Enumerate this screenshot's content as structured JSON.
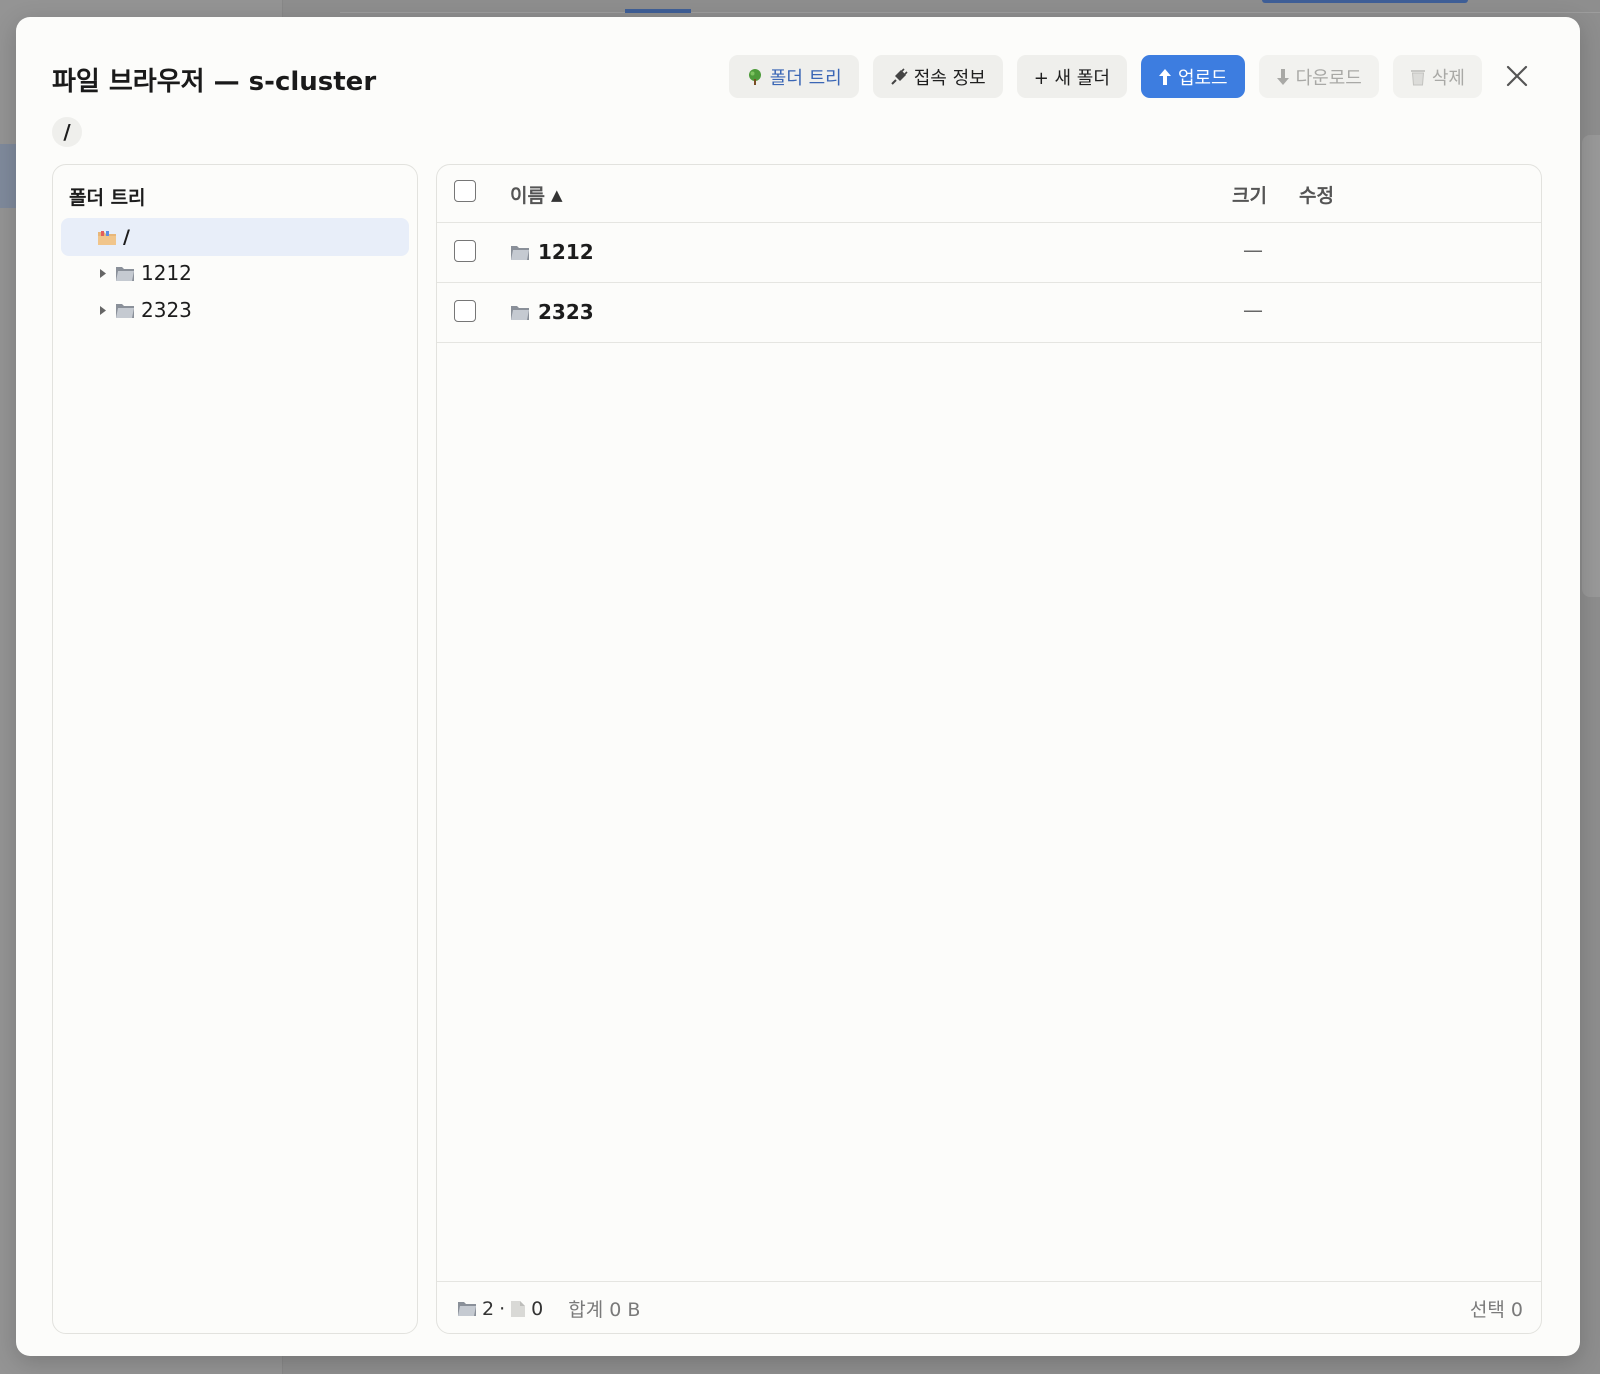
{
  "dialog": {
    "title": "파일 브라우저 — s-cluster",
    "close_icon": "close-icon"
  },
  "toolbar": {
    "folder_tree": "폴더 트리",
    "connection_info": "접속 정보",
    "new_folder": "+ 새 폴더",
    "upload": "업로드",
    "download": "다운로드",
    "delete": "삭제"
  },
  "breadcrumb": {
    "path": "/"
  },
  "tree": {
    "title": "폴더 트리",
    "root": "/",
    "items": [
      {
        "label": "1212"
      },
      {
        "label": "2323"
      }
    ]
  },
  "table": {
    "columns": {
      "name": "이름",
      "size": "크기",
      "modified": "수정"
    },
    "sort_indicator": "▲",
    "rows": [
      {
        "name": "1212",
        "size": "—",
        "modified": ""
      },
      {
        "name": "2323",
        "size": "—",
        "modified": ""
      }
    ]
  },
  "footer": {
    "folder_count": "2",
    "separator": "·",
    "file_count": "0",
    "total": "합계 0 B",
    "selected": "선택 0"
  },
  "colors": {
    "primary": "#3d7de0",
    "tree_accent": "#3a66b5",
    "selected_row": "#e8eef9"
  }
}
